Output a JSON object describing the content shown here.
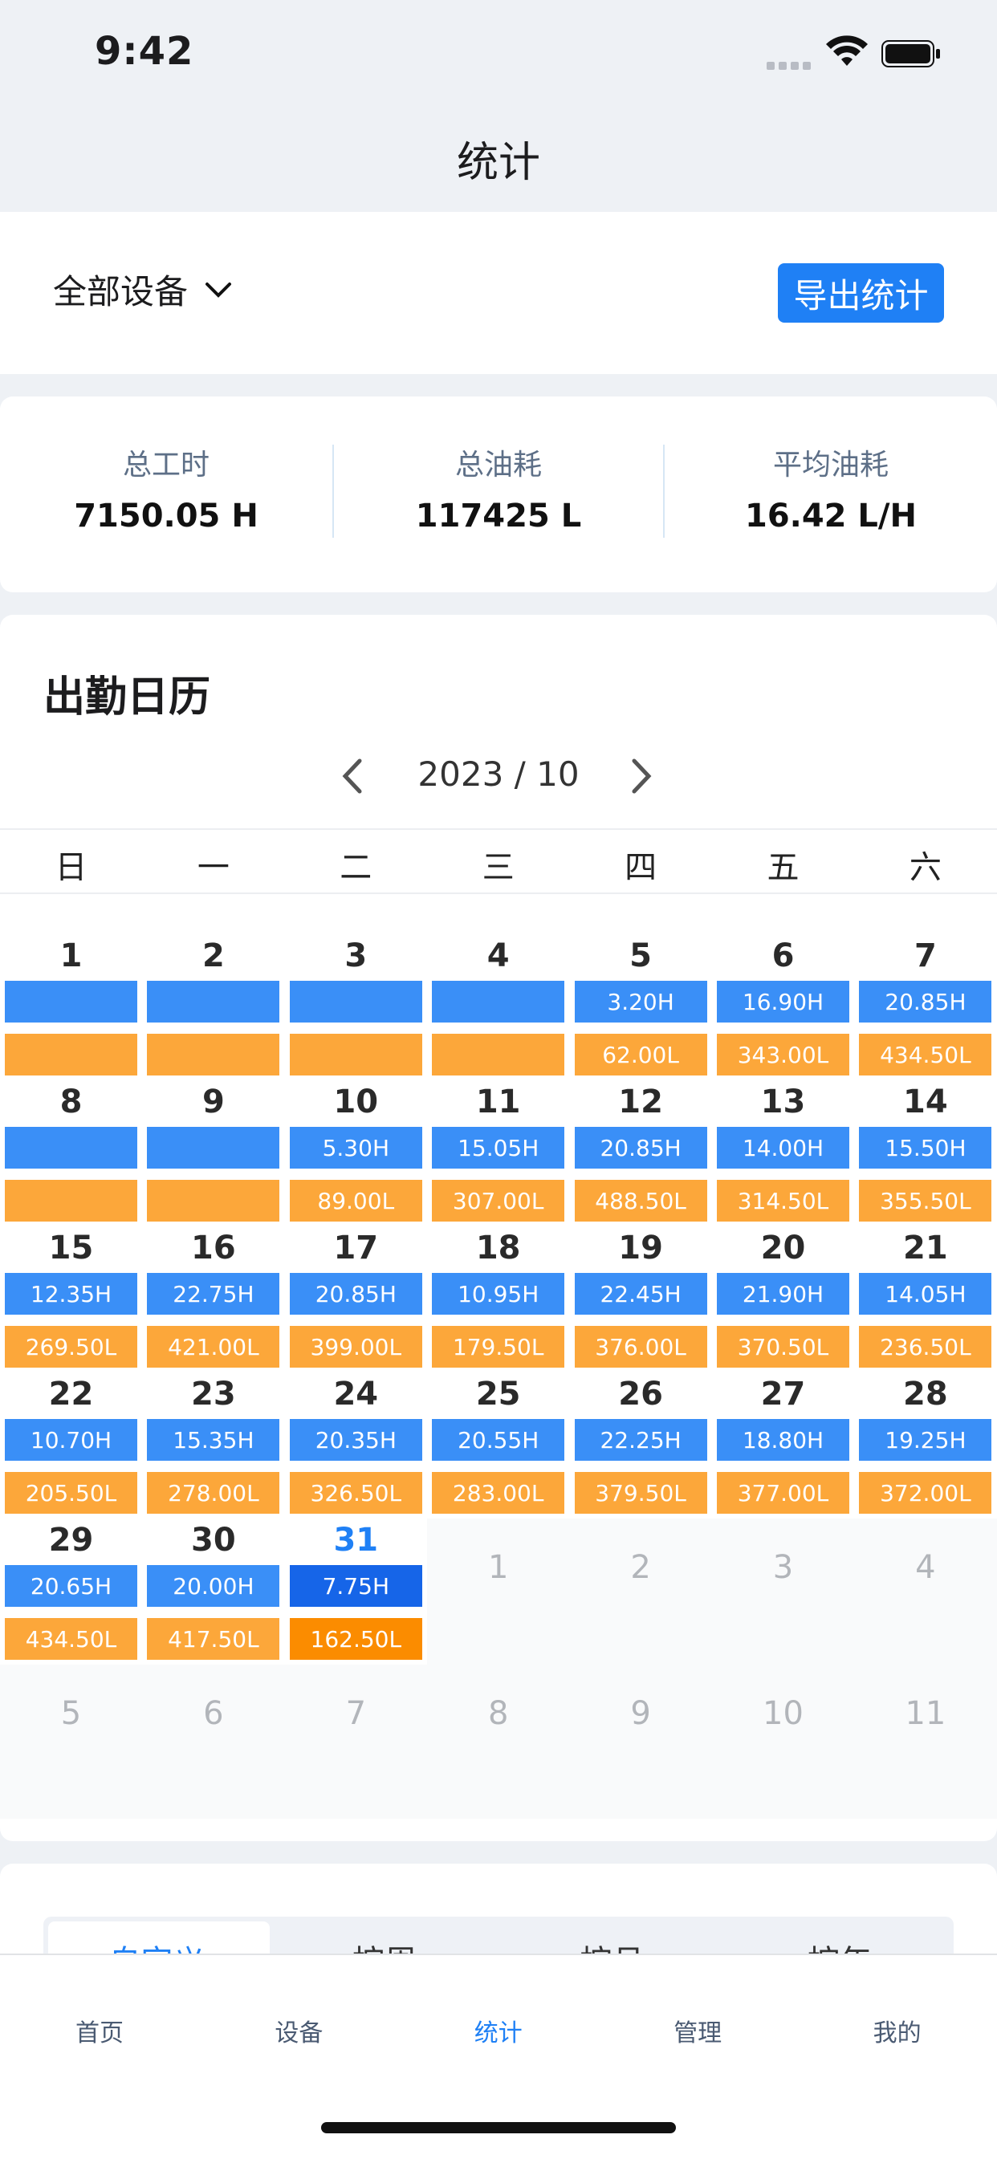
{
  "status": {
    "time": "9:42"
  },
  "header": {
    "title": "统计"
  },
  "device": {
    "selected": "全部设备",
    "export_label": "导出统计"
  },
  "stats": [
    {
      "label": "总工时",
      "value": "7150.05 H"
    },
    {
      "label": "总油耗",
      "value": "117425 L"
    },
    {
      "label": "平均油耗",
      "value": "16.42 L/H"
    }
  ],
  "calendar": {
    "title": "出勤日历",
    "month": "2023 / 10",
    "weekdays": [
      "日",
      "一",
      "二",
      "三",
      "四",
      "五",
      "六"
    ],
    "days": [
      {
        "d": "1",
        "h": "",
        "o": ""
      },
      {
        "d": "2",
        "h": "",
        "o": ""
      },
      {
        "d": "3",
        "h": "",
        "o": ""
      },
      {
        "d": "4",
        "h": "",
        "o": ""
      },
      {
        "d": "5",
        "h": "3.20H",
        "o": "62.00L"
      },
      {
        "d": "6",
        "h": "16.90H",
        "o": "343.00L"
      },
      {
        "d": "7",
        "h": "20.85H",
        "o": "434.50L"
      },
      {
        "d": "8",
        "h": "",
        "o": ""
      },
      {
        "d": "9",
        "h": "",
        "o": ""
      },
      {
        "d": "10",
        "h": "5.30H",
        "o": "89.00L"
      },
      {
        "d": "11",
        "h": "15.05H",
        "o": "307.00L"
      },
      {
        "d": "12",
        "h": "20.85H",
        "o": "488.50L"
      },
      {
        "d": "13",
        "h": "14.00H",
        "o": "314.50L"
      },
      {
        "d": "14",
        "h": "15.50H",
        "o": "355.50L"
      },
      {
        "d": "15",
        "h": "12.35H",
        "o": "269.50L"
      },
      {
        "d": "16",
        "h": "22.75H",
        "o": "421.00L"
      },
      {
        "d": "17",
        "h": "20.85H",
        "o": "399.00L"
      },
      {
        "d": "18",
        "h": "10.95H",
        "o": "179.50L"
      },
      {
        "d": "19",
        "h": "22.45H",
        "o": "376.00L"
      },
      {
        "d": "20",
        "h": "21.90H",
        "o": "370.50L"
      },
      {
        "d": "21",
        "h": "14.05H",
        "o": "236.50L"
      },
      {
        "d": "22",
        "h": "10.70H",
        "o": "205.50L"
      },
      {
        "d": "23",
        "h": "15.35H",
        "o": "278.00L"
      },
      {
        "d": "24",
        "h": "20.35H",
        "o": "326.50L"
      },
      {
        "d": "25",
        "h": "20.55H",
        "o": "283.00L"
      },
      {
        "d": "26",
        "h": "22.25H",
        "o": "379.50L"
      },
      {
        "d": "27",
        "h": "18.80H",
        "o": "377.00L"
      },
      {
        "d": "28",
        "h": "19.25H",
        "o": "372.00L"
      },
      {
        "d": "29",
        "h": "20.65H",
        "o": "434.50L"
      },
      {
        "d": "30",
        "h": "20.00H",
        "o": "417.50L"
      },
      {
        "d": "31",
        "h": "7.75H",
        "o": "162.50L",
        "today": true
      }
    ],
    "trailing_days": [
      "1",
      "2",
      "3",
      "4",
      "5",
      "6",
      "7",
      "8",
      "9",
      "10",
      "11"
    ]
  },
  "period_tabs": [
    {
      "label": "自定义",
      "active": true
    },
    {
      "label": "按周"
    },
    {
      "label": "按月"
    },
    {
      "label": "按年"
    }
  ],
  "bottom_nav": [
    {
      "label": "首页"
    },
    {
      "label": "设备"
    },
    {
      "label": "统计",
      "active": true
    },
    {
      "label": "管理"
    },
    {
      "label": "我的"
    }
  ],
  "colors": {
    "accent": "#1f80f5",
    "hours": "#3a8ff7",
    "oil": "#fca73a"
  },
  "icons": [
    "wifi-icon",
    "battery-icon",
    "chevron-down-icon",
    "chevron-left-icon",
    "chevron-right-icon"
  ]
}
